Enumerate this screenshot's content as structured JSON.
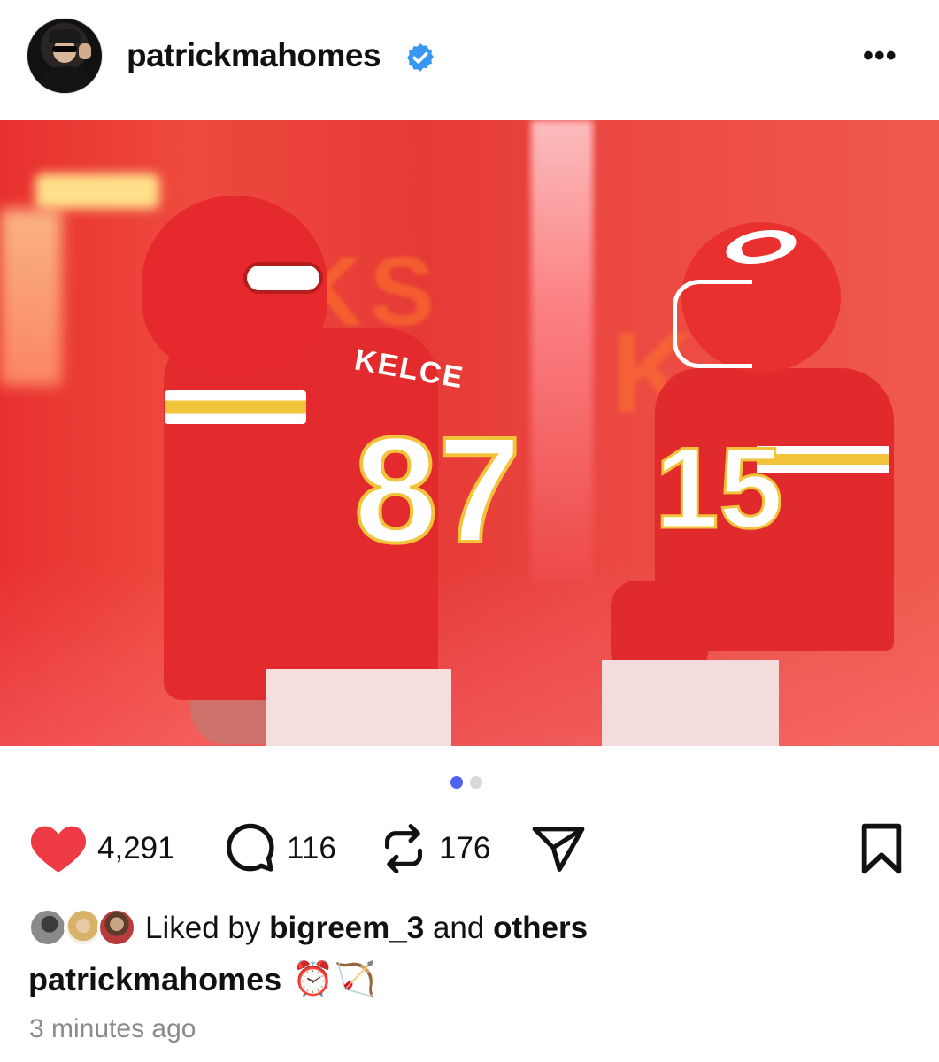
{
  "post": {
    "username": "patrickmahomes",
    "verified": true,
    "more_icon": "more-horizontal-icon",
    "more_label": "•••"
  },
  "media": {
    "description": "",
    "carousel": {
      "count": 2,
      "active": 1
    }
  },
  "actions": {
    "like": {
      "icon": "heart-icon",
      "count": "4,291",
      "liked": true,
      "color": "#ed3a45"
    },
    "comment": {
      "icon": "comment-icon",
      "count": "116"
    },
    "repost": {
      "icon": "repost-icon",
      "count": "176"
    },
    "share": {
      "icon": "send-icon"
    },
    "save": {
      "icon": "bookmark-icon"
    }
  },
  "likes": {
    "prefix": "Liked by",
    "user": "bigreem_3",
    "and": "and",
    "others": "others"
  },
  "caption": {
    "user": "patrickmahomes",
    "text": "⏰🏹"
  },
  "timestamp": "3 minutes ago",
  "colors": {
    "accent": "#4f63f1",
    "verified": "#3897f0",
    "heart": "#ed3a45",
    "muted": "#8a8a8a"
  }
}
